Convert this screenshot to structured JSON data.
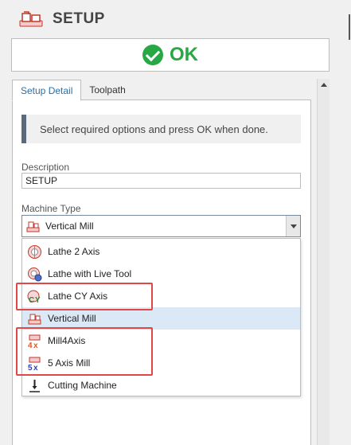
{
  "header": {
    "title": "SETUP",
    "icon": "setup-machine-icon"
  },
  "ok_button": {
    "label": "OK",
    "icon": "check-circle-icon"
  },
  "tabs": [
    {
      "label": "Setup Detail",
      "active": true
    },
    {
      "label": "Toolpath",
      "active": false
    }
  ],
  "info": {
    "message": "Select required options and press OK when done."
  },
  "description": {
    "label": "Description",
    "value": "SETUP"
  },
  "machine_type": {
    "label": "Machine Type",
    "selected": "Vertical Mill",
    "options": [
      {
        "label": "Lathe 2 Axis",
        "icon": "lathe-2-axis-icon"
      },
      {
        "label": "Lathe with Live Tool",
        "icon": "lathe-live-tool-icon"
      },
      {
        "label": "Lathe CY Axis",
        "icon": "lathe-cy-axis-icon"
      },
      {
        "label": "Vertical Mill",
        "icon": "vertical-mill-icon"
      },
      {
        "label": "Mill4Axis",
        "icon": "mill-4-axis-icon"
      },
      {
        "label": "5 Axis Mill",
        "icon": "mill-5-axis-icon"
      },
      {
        "label": "Cutting Machine",
        "icon": "cutting-machine-icon"
      }
    ]
  },
  "colors": {
    "ok_green": "#27a844",
    "tab_blue": "#2b6ea6",
    "highlight_red": "#e04848",
    "selected_bg": "#dbe9f6"
  }
}
